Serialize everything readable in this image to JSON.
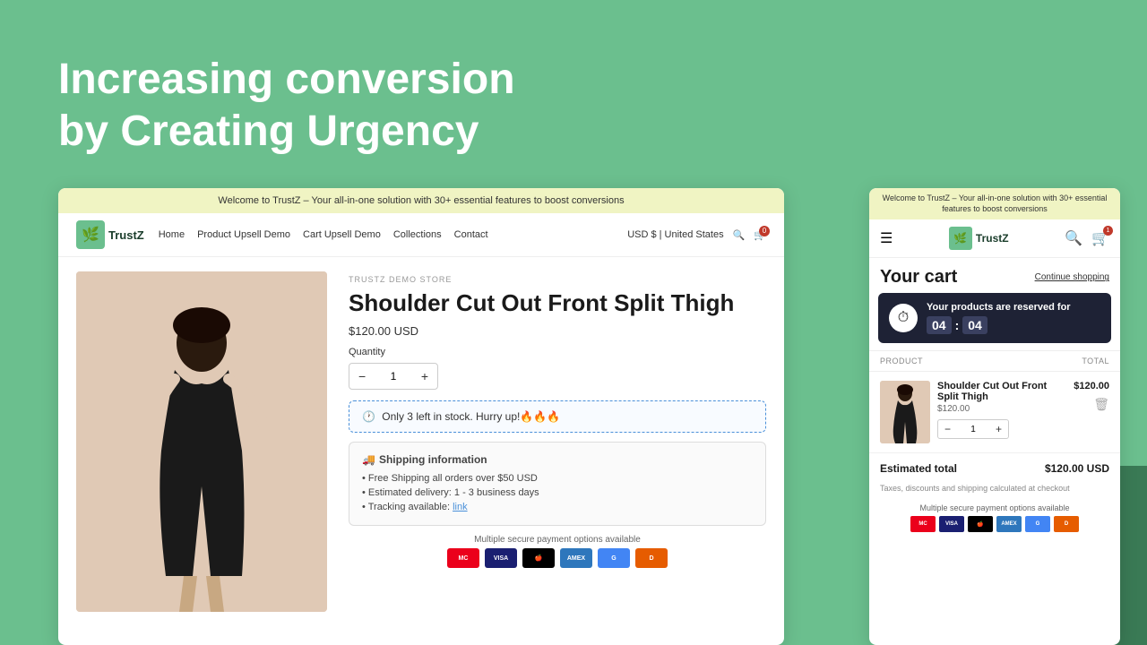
{
  "background": {
    "color": "#6bbf8e"
  },
  "headline": {
    "line1": "Increasing conversion",
    "line2_regular": "by ",
    "line2_highlight": "Creating Urgency"
  },
  "desktop": {
    "announcement": "Welcome to TrustZ – Your all-in-one solution with 30+ essential features to boost conversions",
    "nav": {
      "logo_text": "TrustZ",
      "links": [
        "Home",
        "Product Upsell Demo",
        "Cart Upsell Demo",
        "Collections",
        "Contact"
      ],
      "currency": "USD $ | United States",
      "cart_count": "0"
    },
    "product": {
      "store_label": "TRUSTZ DEMO STORE",
      "title": "Shoulder Cut Out Front Split Thigh",
      "price": "$120.00 USD",
      "quantity_label": "Quantity",
      "quantity_value": "1",
      "stock_alert": "Only 3 left in stock. Hurry up!🔥🔥🔥",
      "shipping_title": "Shipping information",
      "shipping_items": [
        "Free Shipping all orders over $50 USD",
        "Estimated delivery: 1 - 3 business days",
        "Tracking available: link"
      ],
      "payment_label": "Multiple secure payment options available"
    }
  },
  "mobile": {
    "announcement": "Welcome to TrustZ – Your all-in-one solution with 30+ essential features to boost conversions",
    "nav": {
      "logo_text": "TrustZ",
      "cart_count": "1"
    },
    "cart": {
      "title": "Your cart",
      "continue_label": "Continue shopping",
      "timer": {
        "text": "Your products are reserved for",
        "minutes": "04",
        "seconds": "04"
      },
      "table_headers": {
        "product": "PRODUCT",
        "total": "TOTAL"
      },
      "item": {
        "name": "Shoulder Cut Out Front Split Thigh",
        "sub_price": "$120.00",
        "quantity": "1",
        "price": "$120.00"
      },
      "estimated_total_label": "Estimated total",
      "estimated_total_value": "$120.00 USD",
      "estimated_note": "Taxes, discounts and shipping calculated at checkout",
      "payment_label": "Multiple secure payment options available"
    }
  },
  "payment_methods": [
    "MC",
    "VISA",
    "Apple",
    "AMEX",
    "GPay",
    "Disc"
  ],
  "payment_colors": {
    "MC": "#eb001b",
    "VISA": "#1a1f71",
    "Apple": "#000000",
    "AMEX": "#2e77bc",
    "GPay": "#4285f4",
    "Disc": "#e65c00"
  }
}
